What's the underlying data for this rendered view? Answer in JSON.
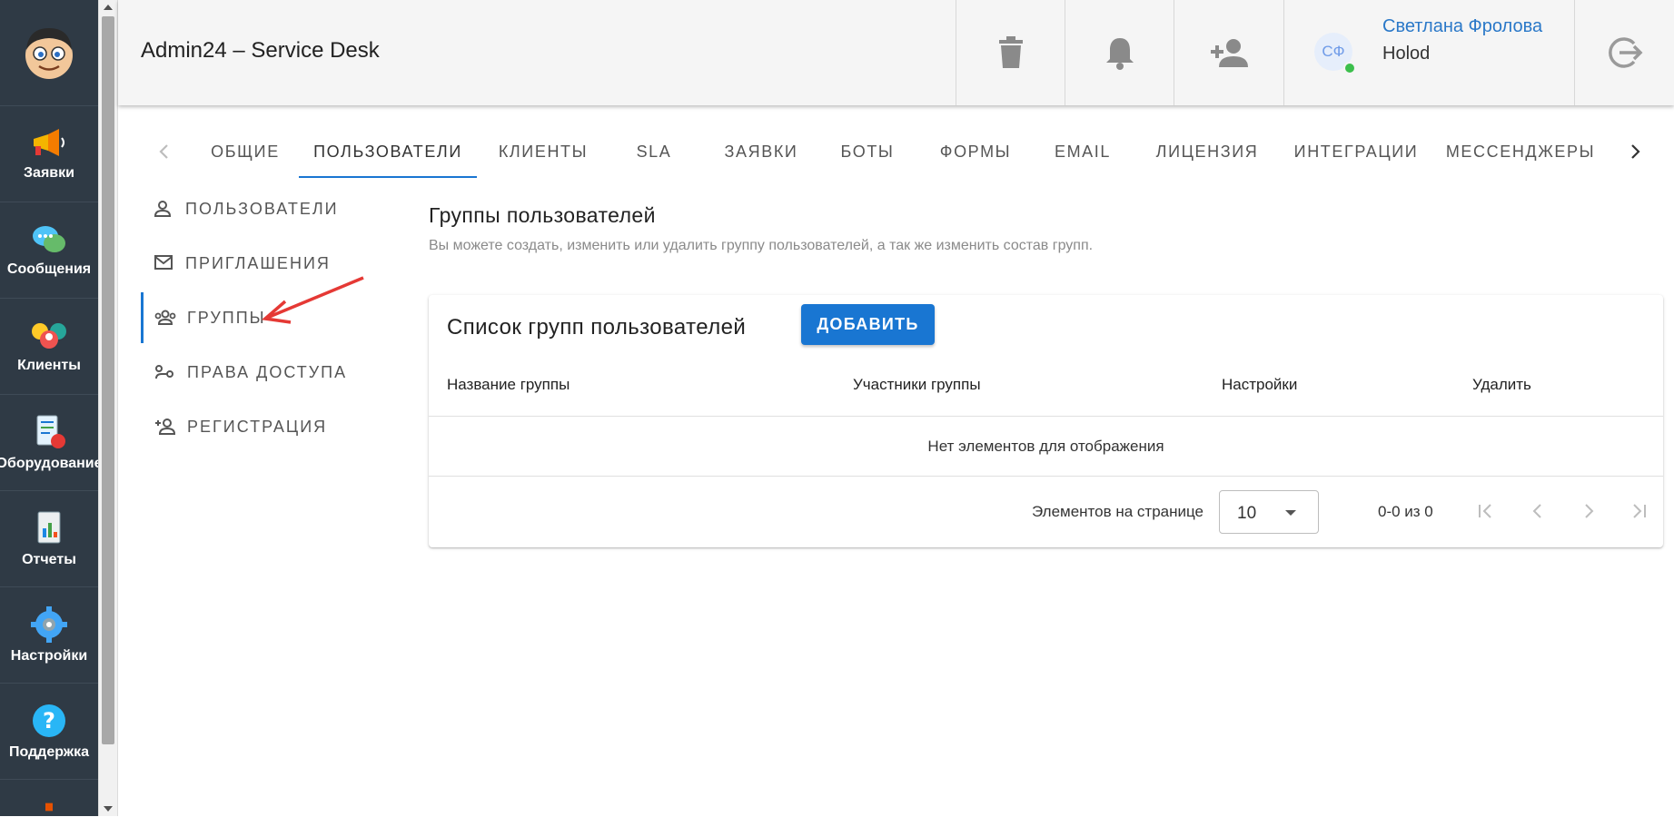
{
  "app": {
    "title": "Admin24 – Service Desk"
  },
  "sidebar": {
    "items": [
      {
        "label": "Заявки",
        "icon": "megaphone-icon"
      },
      {
        "label": "Сообщения",
        "icon": "chat-bubbles-icon"
      },
      {
        "label": "Клиенты",
        "icon": "clients-icon"
      },
      {
        "label": "Оборудование",
        "icon": "equipment-icon"
      },
      {
        "label": "Отчеты",
        "icon": "report-icon"
      },
      {
        "label": "Настройки",
        "icon": "gear-icon"
      },
      {
        "label": "Поддержка",
        "icon": "help-icon"
      }
    ]
  },
  "header": {
    "user": {
      "initials": "СФ",
      "name": "Светлана Фролова",
      "company": "Holod"
    }
  },
  "tabs": {
    "items": [
      "ОБЩИЕ",
      "ПОЛЬЗОВАТЕЛИ",
      "КЛИЕНТЫ",
      "SLA",
      "ЗАЯВКИ",
      "БОТЫ",
      "ФОРМЫ",
      "EMAIL",
      "ЛИЦЕНЗИЯ",
      "ИНТЕГРАЦИИ",
      "МЕССЕНДЖЕРЫ"
    ],
    "active": "ПОЛЬЗОВАТЕЛИ"
  },
  "subnav": {
    "items": [
      "ПОЛЬЗОВАТЕЛИ",
      "ПРИГЛАШЕНИЯ",
      "ГРУППЫ",
      "ПРАВА ДОСТУПА",
      "РЕГИСТРАЦИЯ"
    ],
    "active": "ГРУППЫ"
  },
  "content": {
    "title": "Группы пользователей",
    "description": "Вы можете создать, изменить или удалить группу пользователей, а так же изменить состав групп."
  },
  "card": {
    "title": "Список групп пользователей",
    "add_label": "ДОБАВИТЬ",
    "columns": [
      "Название группы",
      "Участники группы",
      "Настройки",
      "Удалить"
    ],
    "empty_text": "Нет элементов для отображения",
    "pagination": {
      "per_page_label": "Элементов на странице",
      "per_page_value": "10",
      "range": "0-0 из 0"
    }
  },
  "colors": {
    "accent": "#1976d2",
    "sidebar_bg": "#2f3a45",
    "user_name": "#2a78c8",
    "online": "#3cbf4c",
    "annotation": "#e53935"
  }
}
